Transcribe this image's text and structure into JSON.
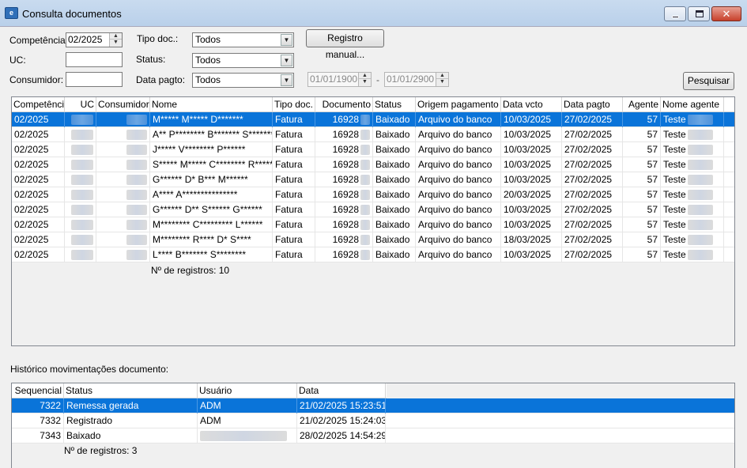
{
  "window": {
    "title": "Consulta documentos",
    "icon": "app-logo-icon"
  },
  "filters": {
    "competencia_label": "Competência:",
    "competencia_value": "02/2025",
    "uc_label": "UC:",
    "uc_value": "",
    "consumidor_label": "Consumidor:",
    "consumidor_value": "",
    "tipo_doc_label": "Tipo doc.:",
    "tipo_doc_value": "Todos",
    "status_label": "Status:",
    "status_value": "Todos",
    "data_pagto_label": "Data pagto:",
    "data_pagto_value": "Todos",
    "date_from": "01/01/1900",
    "date_sep": "-",
    "date_to": "01/01/2900",
    "registro_manual_label": "Registro manual...",
    "pesquisar_label": "Pesquisar"
  },
  "documents": {
    "headers": [
      "Competência",
      "UC",
      "Consumidor",
      "Nome",
      "Tipo doc.",
      "Documento",
      "Status",
      "Origem pagamento",
      "Data vcto",
      "Data pagto",
      "Agente",
      "Nome agente"
    ],
    "rows": [
      {
        "competencia": "02/2025",
        "nome": "M***** M***** D*******",
        "tipo": "Fatura",
        "documento": "16928",
        "status": "Baixado",
        "origem": "Arquivo do banco",
        "vcto": "10/03/2025",
        "pagto": "27/02/2025",
        "agente": "57",
        "nome_agente": "Teste"
      },
      {
        "competencia": "02/2025",
        "nome": "A** P******** B******* S*******",
        "tipo": "Fatura",
        "documento": "16928",
        "status": "Baixado",
        "origem": "Arquivo do banco",
        "vcto": "10/03/2025",
        "pagto": "27/02/2025",
        "agente": "57",
        "nome_agente": "Teste"
      },
      {
        "competencia": "02/2025",
        "nome": "J***** V******** P******",
        "tipo": "Fatura",
        "documento": "16928",
        "status": "Baixado",
        "origem": "Arquivo do banco",
        "vcto": "10/03/2025",
        "pagto": "27/02/2025",
        "agente": "57",
        "nome_agente": "Teste"
      },
      {
        "competencia": "02/2025",
        "nome": "S***** M***** C******** R*******",
        "tipo": "Fatura",
        "documento": "16928",
        "status": "Baixado",
        "origem": "Arquivo do banco",
        "vcto": "10/03/2025",
        "pagto": "27/02/2025",
        "agente": "57",
        "nome_agente": "Teste"
      },
      {
        "competencia": "02/2025",
        "nome": "G****** D* B*** M******",
        "tipo": "Fatura",
        "documento": "16928",
        "status": "Baixado",
        "origem": "Arquivo do banco",
        "vcto": "10/03/2025",
        "pagto": "27/02/2025",
        "agente": "57",
        "nome_agente": "Teste"
      },
      {
        "competencia": "02/2025",
        "nome": "A**** A***************",
        "tipo": "Fatura",
        "documento": "16928",
        "status": "Baixado",
        "origem": "Arquivo do banco",
        "vcto": "20/03/2025",
        "pagto": "27/02/2025",
        "agente": "57",
        "nome_agente": "Teste"
      },
      {
        "competencia": "02/2025",
        "nome": "G****** D** S****** G******",
        "tipo": "Fatura",
        "documento": "16928",
        "status": "Baixado",
        "origem": "Arquivo do banco",
        "vcto": "10/03/2025",
        "pagto": "27/02/2025",
        "agente": "57",
        "nome_agente": "Teste"
      },
      {
        "competencia": "02/2025",
        "nome": "M******** C********* L******",
        "tipo": "Fatura",
        "documento": "16928",
        "status": "Baixado",
        "origem": "Arquivo do banco",
        "vcto": "10/03/2025",
        "pagto": "27/02/2025",
        "agente": "57",
        "nome_agente": "Teste"
      },
      {
        "competencia": "02/2025",
        "nome": "M******** R**** D* S****",
        "tipo": "Fatura",
        "documento": "16928",
        "status": "Baixado",
        "origem": "Arquivo do banco",
        "vcto": "18/03/2025",
        "pagto": "27/02/2025",
        "agente": "57",
        "nome_agente": "Teste"
      },
      {
        "competencia": "02/2025",
        "nome": "L**** B******* S********",
        "tipo": "Fatura",
        "documento": "16928",
        "status": "Baixado",
        "origem": "Arquivo do banco",
        "vcto": "10/03/2025",
        "pagto": "27/02/2025",
        "agente": "57",
        "nome_agente": "Teste"
      }
    ],
    "count_label": "Nº de registros: 10"
  },
  "history": {
    "section_label": "Histórico movimentações documento:",
    "headers": [
      "Sequencial",
      "Status",
      "Usuário",
      "Data"
    ],
    "rows": [
      {
        "seq": "7322",
        "status": "Remessa gerada",
        "usuario": "ADM",
        "data": "21/02/2025 15:23:51"
      },
      {
        "seq": "7332",
        "status": "Registrado",
        "usuario": "ADM",
        "data": "21/02/2025 15:24:03"
      },
      {
        "seq": "7343",
        "status": "Baixado",
        "usuario": "",
        "data": "28/02/2025 14:54:29"
      }
    ],
    "count_label": "Nº de registros: 3"
  },
  "colors": {
    "selection": "#0a74d9",
    "titlebar": "#c9dbef",
    "close": "#c7402b"
  }
}
